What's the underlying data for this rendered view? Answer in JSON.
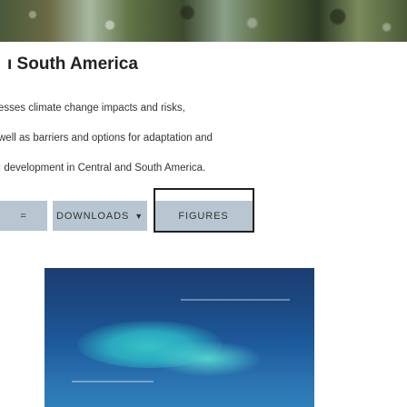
{
  "banner": {
    "image_name": "landscape-photo"
  },
  "heading": {
    "title": "ı South America"
  },
  "description": {
    "lines": [
      "esses climate change impacts and risks,",
      "well as barriers and options for adaptation and",
      ": development in Central and South America."
    ]
  },
  "toolbar": {
    "left_label": "=",
    "downloads_label": "DOWNLOADS",
    "downloads_icon": "chevron-down-icon",
    "figures_label": "FIGURES"
  },
  "photo": {
    "image_name": "aerial-reef-photo"
  }
}
